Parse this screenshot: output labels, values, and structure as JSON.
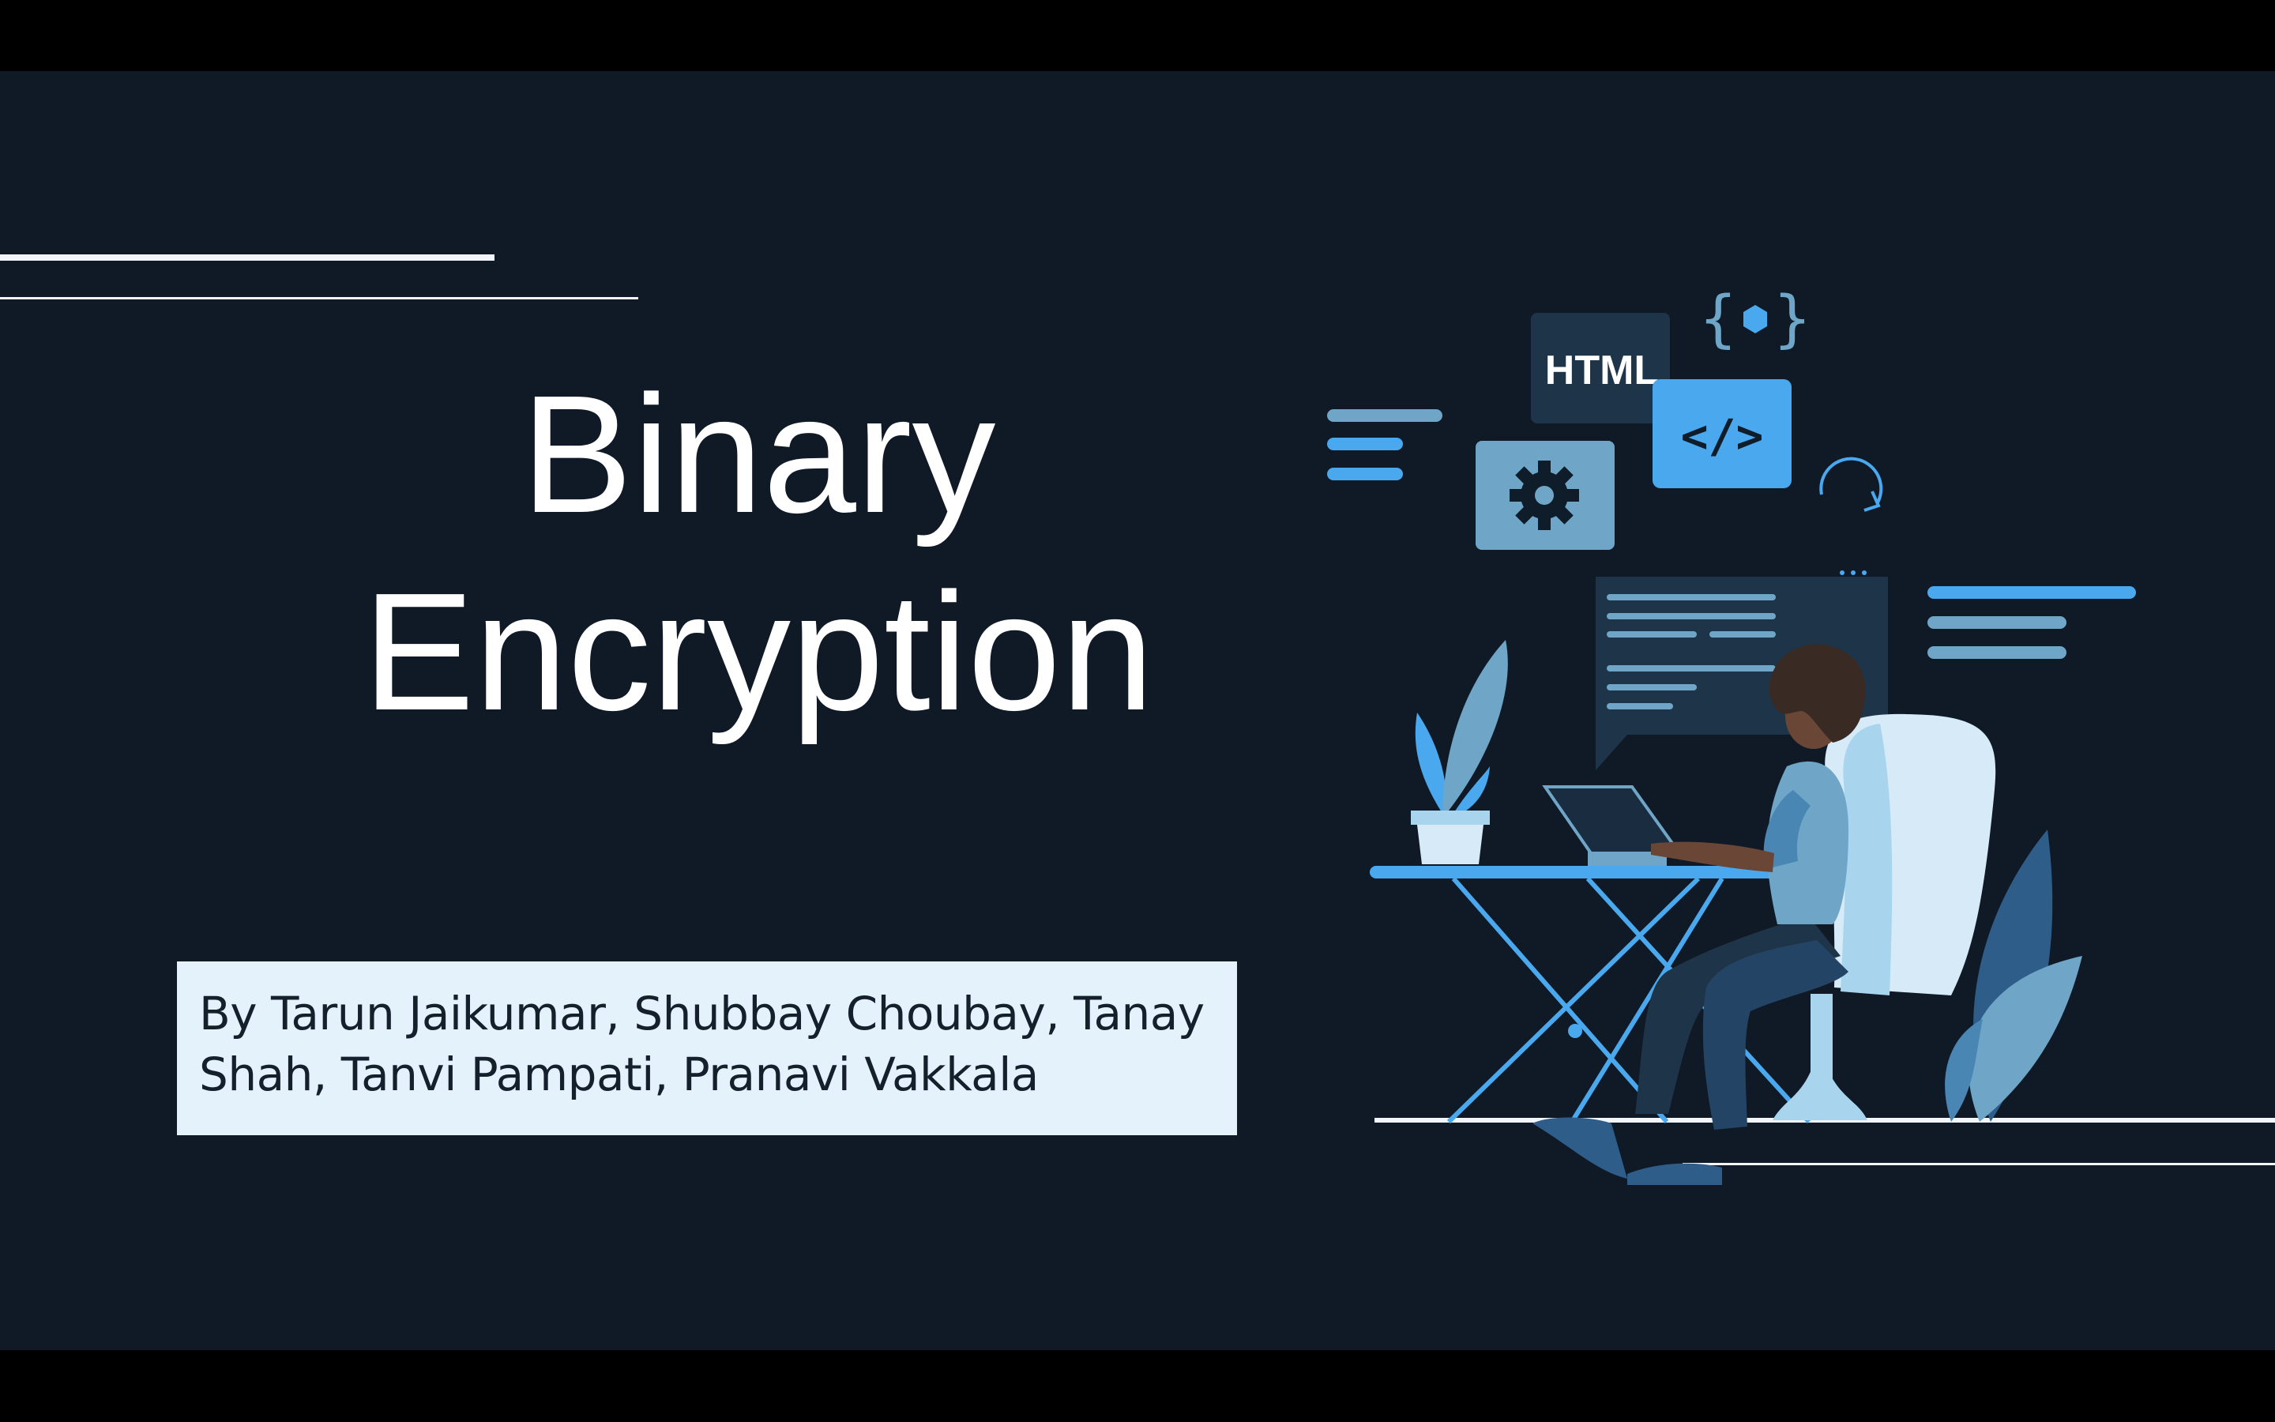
{
  "slide": {
    "title_line_1": "Binary",
    "title_line_2": "Encryption",
    "authors": "By Tarun Jaikumar, Shubbay Choubay, Tanay Shah, Tanvi Pampati, Pranavi Vakkala"
  },
  "illustration": {
    "html_card_label": "HTML",
    "code_card_label": "</>",
    "bracket_label": "{ }"
  },
  "colors": {
    "background": "#101a26",
    "accent_blue": "#4aa8ee",
    "light_blue": "#a8d4ee",
    "card_dark": "#1e3448",
    "author_box": "#e3f2fb",
    "text_white": "#ffffff"
  }
}
